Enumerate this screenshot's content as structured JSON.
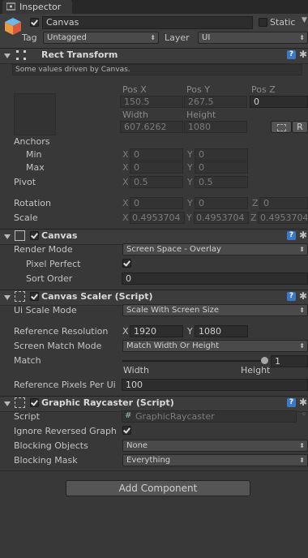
{
  "tab": {
    "label": "Inspector"
  },
  "header": {
    "name": "Canvas",
    "static_label": "Static",
    "tag_label": "Tag",
    "tag_value": "Untagged",
    "layer_label": "Layer",
    "layer_value": "UI"
  },
  "rect_transform": {
    "title": "Rect Transform",
    "note": "Some values driven by Canvas.",
    "pos_x_label": "Pos X",
    "pos_y_label": "Pos Y",
    "pos_z_label": "Pos Z",
    "pos_x": "150.5",
    "pos_y": "267.5",
    "pos_z": "0",
    "width_label": "Width",
    "height_label": "Height",
    "width": "607.6262",
    "height": "1080",
    "r_label": "R",
    "anchors_label": "Anchors",
    "min_label": "Min",
    "max_label": "Max",
    "x": "X",
    "y": "Y",
    "z": "Z",
    "min_x": "0",
    "min_y": "0",
    "max_x": "0",
    "max_y": "0",
    "pivot_label": "Pivot",
    "pivot_x": "0.5",
    "pivot_y": "0.5",
    "rotation_label": "Rotation",
    "rot_x": "0",
    "rot_y": "0",
    "rot_z": "0",
    "scale_label": "Scale",
    "scale_x": "0.4953704",
    "scale_y": "0.4953704",
    "scale_z": "0.4953704"
  },
  "canvas": {
    "title": "Canvas",
    "render_mode_label": "Render Mode",
    "render_mode": "Screen Space - Overlay",
    "pixel_perfect_label": "Pixel Perfect",
    "sort_order_label": "Sort Order",
    "sort_order": "0"
  },
  "canvas_scaler": {
    "title": "Canvas Scaler (Script)",
    "ui_scale_mode_label": "Ui Scale Mode",
    "ui_scale_mode": "Scale With Screen Size",
    "ref_res_label": "Reference Resolution",
    "ref_x": "1920",
    "ref_y": "1080",
    "screen_match_label": "Screen Match Mode",
    "screen_match": "Match Width Or Height",
    "match_label": "Match",
    "match_value": "1",
    "match_fraction": 1,
    "width_label": "Width",
    "height_label": "Height",
    "ref_ppu_label": "Reference Pixels Per Ui",
    "ref_ppu": "100"
  },
  "raycaster": {
    "title": "Graphic Raycaster (Script)",
    "script_label": "Script",
    "script_value": "GraphicRaycaster",
    "ignore_label": "Ignore Reversed Graph",
    "blocking_objects_label": "Blocking Objects",
    "blocking_objects": "None",
    "blocking_mask_label": "Blocking Mask",
    "blocking_mask": "Everything"
  },
  "add_component": "Add Component",
  "colors": {
    "help": "#3a78c9",
    "background": "#383838"
  }
}
